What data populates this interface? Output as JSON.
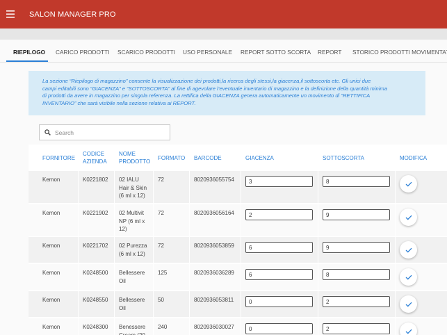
{
  "app": {
    "title": "SALON MANAGER PRO",
    "menu_icon": "menu-icon",
    "accent": "#c1392b",
    "link_color": "#2a7fd6"
  },
  "tabs": [
    {
      "label": "RIEPILOGO",
      "active": true
    },
    {
      "label": "CARICO PRODOTTI",
      "active": false
    },
    {
      "label": "SCARICO PRODOTTI",
      "active": false
    },
    {
      "label": "USO PERSONALE",
      "active": false
    },
    {
      "label": "REPORT SOTTO SCORTA",
      "active": false
    },
    {
      "label": "REPORT",
      "active": false
    },
    {
      "label": "STORICO PRODOTTI MOVIMENTATI",
      "active": false
    }
  ],
  "info": {
    "lines": [
      "La sezione “Riepilogo di magazzino” consente la visualizzazione dei prodotti,la ricerca degli stessi,la giacenza,il sottoscorta etc. Gli unici due",
      "campi editabili sono “GIACENZA” e “SOTTOSCORTA” al fine di agevolare l’eventuale inventario di magazzino e la definizione della quantità minima",
      "di prodotti da avere in magazzino per singola referenza. La rettifica della GIACENZA genera automaticamente un movimento di “RETTIFICA",
      "INVENTARIO” che sarà visibile nella sezione relativa ai REPORT."
    ]
  },
  "search": {
    "placeholder": "Search",
    "value": "",
    "icon": "search-icon"
  },
  "table": {
    "headers": {
      "fornitore": [
        "FORNITORE"
      ],
      "codice": [
        "CODICE",
        "AZIENDA"
      ],
      "nome": [
        "NOME",
        "PRODOTTO"
      ],
      "formato": [
        "FORMATO"
      ],
      "barcode": [
        "BARCODE"
      ],
      "giacenza": [
        "GIACENZA"
      ],
      "sottoscorta": [
        "SOTTOSCORTA"
      ],
      "modifica": [
        "MODIFICA"
      ]
    },
    "rows": [
      {
        "fornitore": "Kemon",
        "codice": "K0221802",
        "nome": [
          "02 IALU",
          "Hair & Skin",
          "(6 ml x 12)"
        ],
        "formato": "72",
        "barcode": "8020936055754",
        "giacenza": "3",
        "sottoscorta": "8"
      },
      {
        "fornitore": "Kemon",
        "codice": "K0221902",
        "nome": [
          "02 Multivit",
          "NP (6 ml x",
          "12)"
        ],
        "formato": "72",
        "barcode": "8020936056164",
        "giacenza": "2",
        "sottoscorta": "9"
      },
      {
        "fornitore": "Kemon",
        "codice": "K0221702",
        "nome": [
          "02 Purezza",
          "(6 ml x 12)"
        ],
        "formato": "72",
        "barcode": "8020936053859",
        "giacenza": "6",
        "sottoscorta": "9"
      },
      {
        "fornitore": "Kemon",
        "codice": "K0248500",
        "nome": [
          "Bellessere",
          "Oil"
        ],
        "formato": "125",
        "barcode": "8020936036289",
        "giacenza": "6",
        "sottoscorta": "8"
      },
      {
        "fornitore": "Kemon",
        "codice": "K0248550",
        "nome": [
          "Bellessere",
          "Oil"
        ],
        "formato": "50",
        "barcode": "8020936053811",
        "giacenza": "0",
        "sottoscorta": "2"
      },
      {
        "fornitore": "Kemon",
        "codice": "K0248300",
        "nome": [
          "Benessere",
          "Cream (20"
        ],
        "formato": "240",
        "barcode": "8020936030027",
        "giacenza": "0",
        "sottoscorta": "2"
      }
    ],
    "action_icon": "check-icon"
  }
}
